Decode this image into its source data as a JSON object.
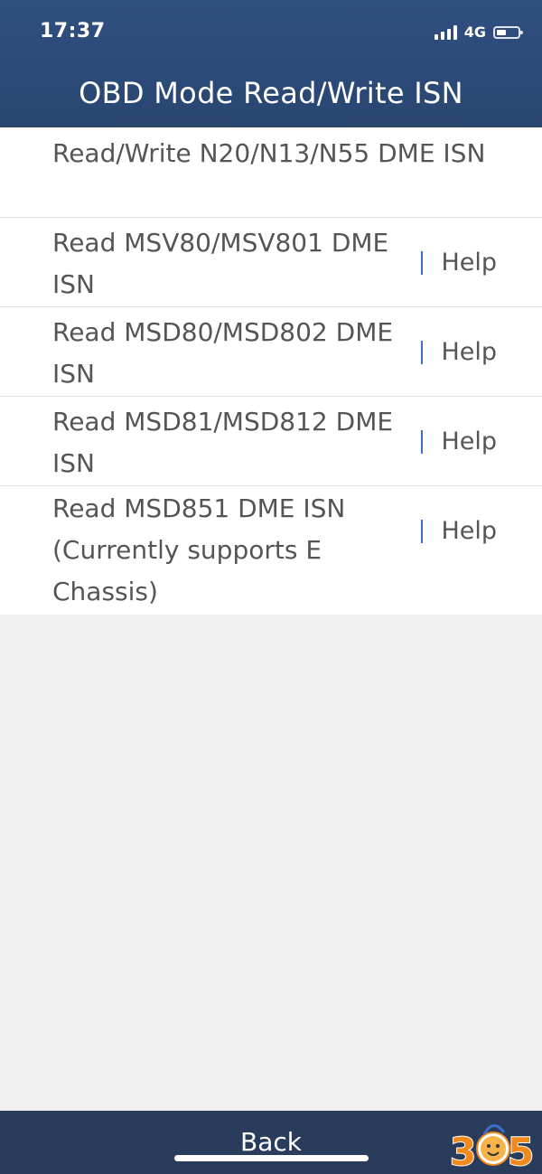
{
  "status_bar": {
    "time": "17:37",
    "network": "4G",
    "signal_icon": "cellular-signal-icon",
    "battery_icon": "battery-icon"
  },
  "header": {
    "title": "OBD Mode Read/Write ISN"
  },
  "items": [
    {
      "label": "Read/Write N20/N13/N55 DME ISN",
      "help": ""
    },
    {
      "label": "Read MSV80/MSV801 DME ISN",
      "help": "Help"
    },
    {
      "label": "Read MSD80/MSD802 DME ISN",
      "help": "Help"
    },
    {
      "label": "Read MSD81/MSD812 DME ISN",
      "help": "Help"
    },
    {
      "label": "Read MSD851 DME ISN (Currently supports E Chassis)",
      "help": "Help"
    }
  ],
  "footer": {
    "back_label": "Back"
  },
  "watermark": {
    "text": "365"
  },
  "colors": {
    "header_bg": "#2c4a78",
    "footer_bg": "#293c5c",
    "page_bg": "#efefef",
    "help_divider": "#3b6fc7",
    "text": "#555555",
    "watermark_orange": "#f08a1c"
  }
}
